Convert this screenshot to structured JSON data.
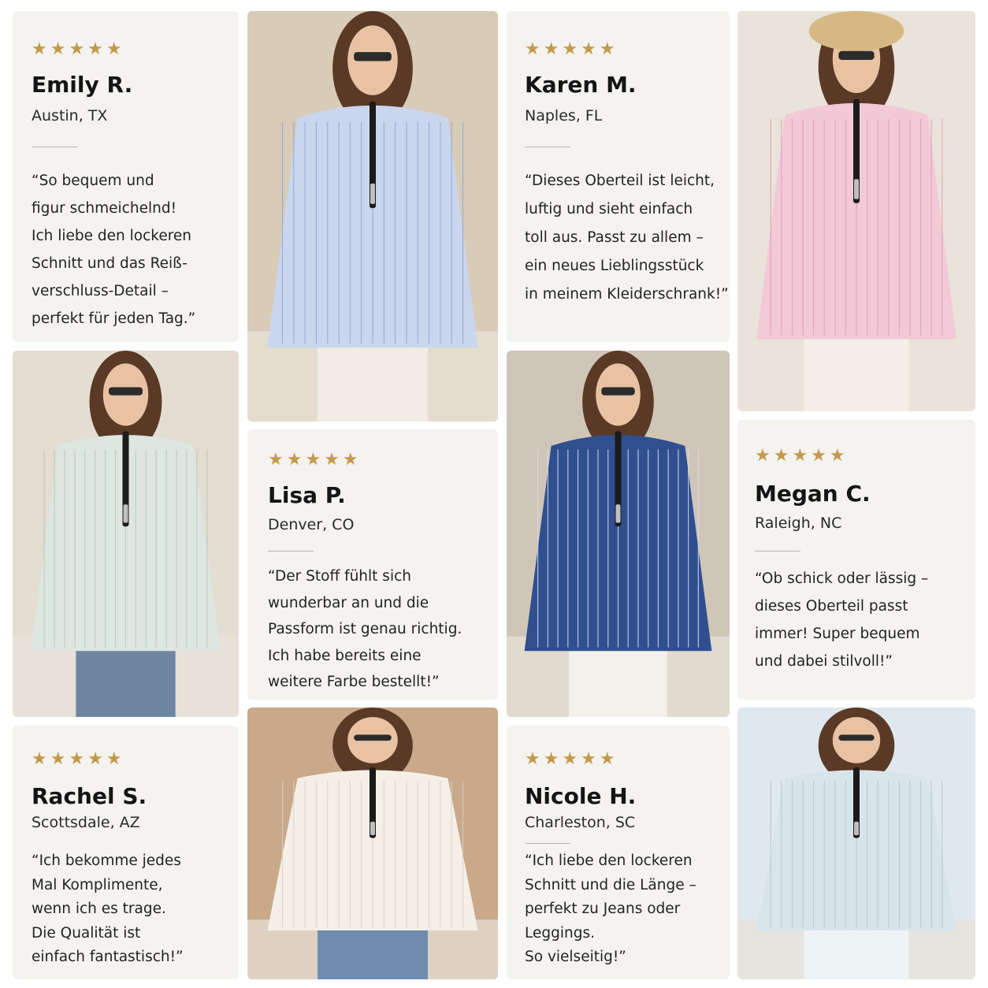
{
  "colors": {
    "card_bg": "#f5f3f0",
    "star": "#c29a4a",
    "text": "#1c1c1c",
    "rule": "#b9b3aa"
  },
  "reviews": [
    {
      "stars": "★★★★★",
      "name": "Emily R.",
      "location": "Austin, TX",
      "quote": "“So bequem und\nfigur schmeichelnd!\nIch liebe den lockeren\nSchnitt und das Reiß-\nverschluss-Detail –\nperfekt für jeden Tag.”"
    },
    {
      "stars": "★★★★★",
      "name": "Karen M.",
      "location": "Naples, FL",
      "quote": "“Dieses Oberteil ist leicht,\nluftig und sieht einfach\ntoll aus. Passt zu allem –\nein neues Lieblingsstück\nin meinem Kleiderschrank!”"
    },
    {
      "stars": "★★★★★",
      "name": "Lisa P.",
      "location": "Denver, CO",
      "quote": "“Der Stoff fühlt sich\nwunderbar an und die\nPassform ist genau richtig.\nIch habe bereits eine\nweitere Farbe bestellt!”"
    },
    {
      "stars": "★★★★★",
      "name": "Megan C.",
      "location": "Raleigh, NC",
      "quote": "“Ob schick oder lässig –\ndieses Oberteil passt\nimmer! Super bequem\nund dabei stilvoll!”"
    },
    {
      "stars": "★★★★★",
      "name": "Rachel S.",
      "location": "Scottsdale, AZ",
      "quote": "“Ich bekomme jedes\nMal Komplimente,\nwenn ich es trage.\nDie Qualität ist\neinfach fantastisch!”"
    },
    {
      "stars": "★★★★★",
      "name": "Nicole H.",
      "location": "Charleston, SC",
      "quote": "“Ich liebe den lockeren\nSchnitt und die Länge –\nperfekt zu Jeans oder\nLeggings.\nSo vielseitig!”"
    }
  ],
  "photos": [
    {
      "shirt": "#c9d6ee",
      "stripe": "#8ea6d6",
      "pants": "#f1ede6",
      "bg": "#d8cbb8",
      "hat": false
    },
    {
      "shirt": "#f3c9d8",
      "stripe": "#e59ab6",
      "pants": "#f3efe8",
      "bg": "#e9e3da",
      "hat": true
    },
    {
      "shirt": "#dde6e1",
      "stripe": "#b6c7be",
      "pants": "#6f86a3",
      "bg": "#e4ddd2",
      "hat": false
    },
    {
      "shirt": "#2f4f8f",
      "stripe": "#d7e0ef",
      "pants": "#f4f1ec",
      "bg": "#cfc6b8",
      "hat": false
    },
    {
      "shirt": "#f4f0e8",
      "stripe": "#d8d2c6",
      "pants": "#6e8db0",
      "bg": "#c9a98a",
      "hat": false
    },
    {
      "shirt": "#d7e5ea",
      "stripe": "#aec6cf",
      "pants": "#eef3f5",
      "bg": "#dfe8ee",
      "hat": false
    }
  ]
}
